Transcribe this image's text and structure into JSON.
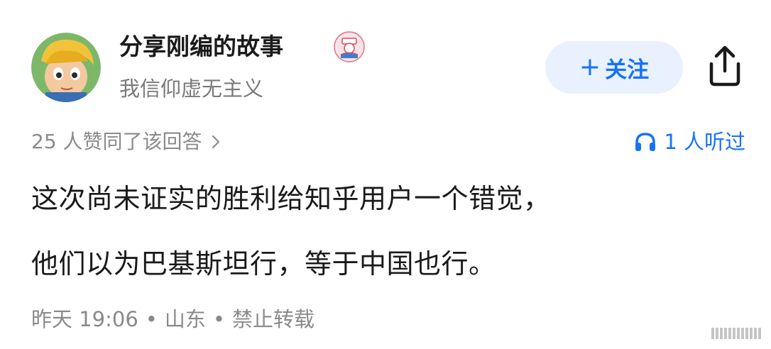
{
  "author": {
    "name": "分享刚编的故事",
    "bio": "我信仰虚无主义",
    "avatar_icon": "cartoon-avatar",
    "badge_icon": "sailor-badge-icon"
  },
  "follow_button": {
    "plus": "+",
    "label": "关注",
    "color": "#1772f6",
    "background": "#e8f1fd"
  },
  "share_icon": "share-icon",
  "stats": {
    "upvote_text": "25 人赞同了该回答",
    "listen_text": "1 人听过"
  },
  "answer": {
    "lines": [
      "这次尚未证实的胜利给知乎用户一个错觉，",
      "他们以为巴基斯坦行，等于中国也行。"
    ]
  },
  "meta": {
    "time": "昨天 19:06",
    "location": "山东",
    "rights": "禁止转载",
    "separator": "•"
  }
}
